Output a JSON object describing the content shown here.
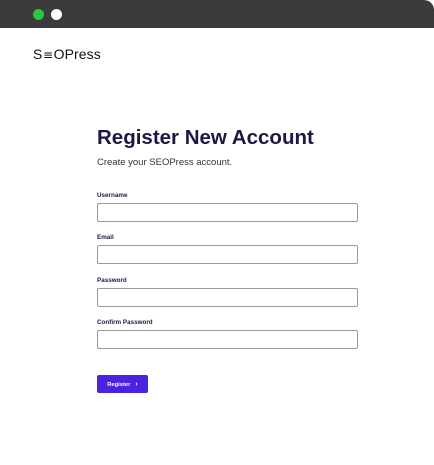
{
  "window": {
    "controls": [
      "close-dot",
      "minimize-dot"
    ]
  },
  "brand": {
    "logo_prefix": "S",
    "logo_symbol": "≡",
    "logo_suffix": "OPress"
  },
  "form": {
    "title": "Register New Account",
    "subtitle": "Create your SEOPress account.",
    "fields": [
      {
        "label": "Username",
        "value": "",
        "placeholder": ""
      },
      {
        "label": "Email",
        "value": "",
        "placeholder": ""
      },
      {
        "label": "Password",
        "value": "",
        "placeholder": ""
      },
      {
        "label": "Confirm Password",
        "value": "",
        "placeholder": ""
      }
    ],
    "submit_label": "Register",
    "submit_icon": "chevron-right-icon",
    "submit_glyph": "›"
  },
  "colors": {
    "titlebar": "#3b3b3b",
    "dot_green": "#28c840",
    "heading": "#1c1845",
    "accent": "#4a22e0"
  }
}
